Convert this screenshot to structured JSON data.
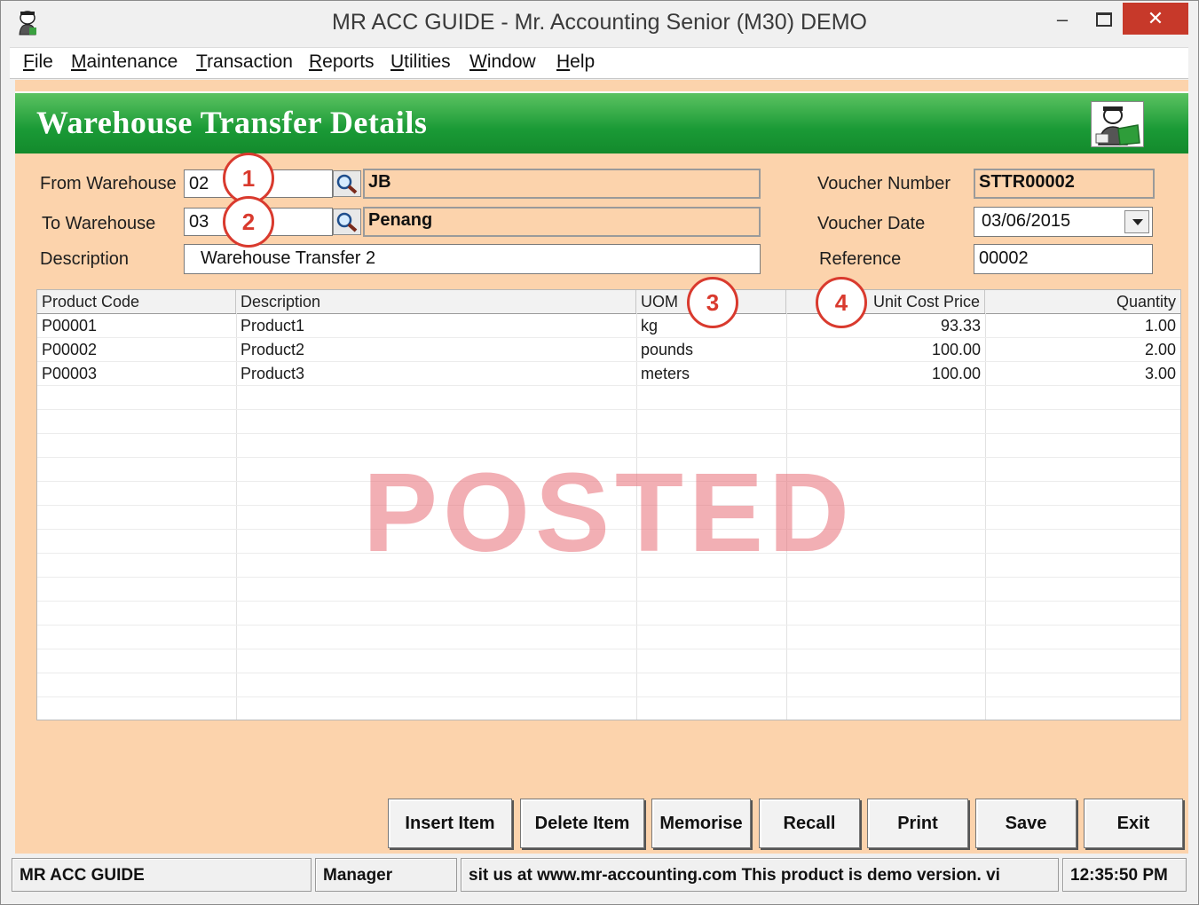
{
  "window": {
    "title": "MR ACC GUIDE - Mr. Accounting Senior (M30) DEMO",
    "minimize": "–",
    "close": "✕"
  },
  "menu": [
    {
      "label": "File",
      "mnemonic": "F",
      "rest": "ile"
    },
    {
      "label": "Maintenance",
      "mnemonic": "M",
      "rest": "aintenance"
    },
    {
      "label": "Transaction",
      "mnemonic": "T",
      "rest": "ransaction"
    },
    {
      "label": "Reports",
      "mnemonic": "R",
      "rest": "eports"
    },
    {
      "label": "Utilities",
      "mnemonic": "U",
      "rest": "tilities"
    },
    {
      "label": "Window",
      "mnemonic": "W",
      "rest": "indow"
    },
    {
      "label": "Help",
      "mnemonic": "H",
      "rest": "elp"
    }
  ],
  "header": {
    "title": "Warehouse Transfer Details"
  },
  "form": {
    "from_warehouse_label": "From Warehouse",
    "from_warehouse_code": "02",
    "from_warehouse_name": "JB",
    "to_warehouse_label": "To Warehouse",
    "to_warehouse_code": "03",
    "to_warehouse_name": "Penang",
    "description_label": "Description",
    "description": "Warehouse Transfer 2",
    "voucher_number_label": "Voucher Number",
    "voucher_number": "STTR00002",
    "voucher_date_label": "Voucher Date",
    "voucher_date": "03/06/2015",
    "reference_label": "Reference",
    "reference": "00002"
  },
  "callouts": [
    "1",
    "2",
    "3",
    "4"
  ],
  "grid": {
    "columns": [
      "Product Code",
      "Description",
      "UOM",
      "Unit Cost Price",
      "Quantity"
    ],
    "rows": [
      {
        "code": "P00001",
        "desc": "Product1",
        "uom": "kg",
        "cost": "93.33",
        "qty": "1.00"
      },
      {
        "code": "P00002",
        "desc": "Product2",
        "uom": "pounds",
        "cost": "100.00",
        "qty": "2.00"
      },
      {
        "code": "P00003",
        "desc": "Product3",
        "uom": "meters",
        "cost": "100.00",
        "qty": "3.00"
      }
    ],
    "watermark": "POSTED"
  },
  "buttons": [
    {
      "label": "Insert Item"
    },
    {
      "label": "Delete Item"
    },
    {
      "label": "Memorise"
    },
    {
      "label": "Recall"
    },
    {
      "label": "Print"
    },
    {
      "label": "Save"
    },
    {
      "label": "Exit"
    }
  ],
  "status": {
    "app": "MR ACC GUIDE",
    "user": "Manager",
    "message": "sit us at www.mr-accounting.com This product is demo version.  vi",
    "time": "12:35:50 PM"
  },
  "colors": {
    "form_background": "#fcd3ac",
    "header_green": "#1a9a36",
    "watermark": "#e86e76",
    "callout": "#d93a2e"
  },
  "icons": [
    "app-icon",
    "search-icon",
    "chevron-down-icon",
    "minimize-icon",
    "maximize-icon",
    "close-icon",
    "header-logo-icon"
  ]
}
